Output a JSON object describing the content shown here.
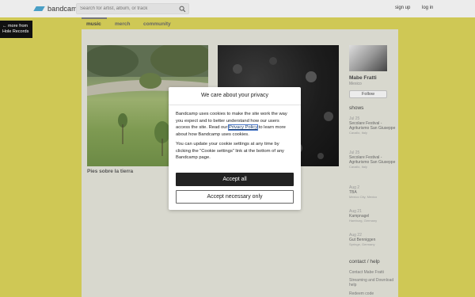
{
  "header": {
    "logo_text": "bandcamp",
    "search_placeholder": "Search for artist, album, or track",
    "signup_label": "sign up",
    "login_label": "log in"
  },
  "more_from": {
    "line1": "← more from",
    "line2": "Hole Records"
  },
  "tabs": [
    {
      "label": "music",
      "active": true
    },
    {
      "label": "merch"
    },
    {
      "label": "community"
    }
  ],
  "albums": [
    {
      "title": "Pies sobre la tierra"
    }
  ],
  "artist": {
    "name": "Mabe Fratti",
    "location": "Mexico",
    "follow_label": "Follow"
  },
  "shows_heading": "shows",
  "shows": [
    {
      "date": "Jul 25",
      "venue": "Secolare Festival - Agriturismo San Giuseppe",
      "place": "Cavallo, Italy"
    },
    {
      "date": "Jul 25",
      "venue": "Secolare Festival - Agriturismo San Giuseppe",
      "place": "Cavallo, Italy"
    },
    {
      "date": "Aug 2",
      "venue": "TBA",
      "place": "Mexico City, Mexico"
    },
    {
      "date": "Aug 21",
      "venue": "Kampnagel",
      "place": "Hamburg, Germany"
    },
    {
      "date": "Aug 22",
      "venue": "Gut Benniggen",
      "place": "Springe, Germany"
    }
  ],
  "help": {
    "heading": "contact / help",
    "links": [
      "Contact Mabe Fratti",
      "Streaming and Download help",
      "Redeem code"
    ]
  },
  "cookie_modal": {
    "title": "We care about your privacy",
    "p1_before": "Bandcamp uses cookies to make the site work the way you expect and to better understand how our users access the site. Read our ",
    "p1_link": "Privacy Policy",
    "p1_after": " to learn more about how Bandcamp uses cookies.",
    "p2": "You can update your cookie settings at any time by clicking the “Cookie settings” link at the bottom of any Bandcamp page.",
    "accept_all_label": "Accept all",
    "accept_necessary_label": "Accept necessary only"
  },
  "colors": {
    "page_background": "#cfc855",
    "logo_accent": "#4a9fc6",
    "primary_button": "#222222"
  }
}
